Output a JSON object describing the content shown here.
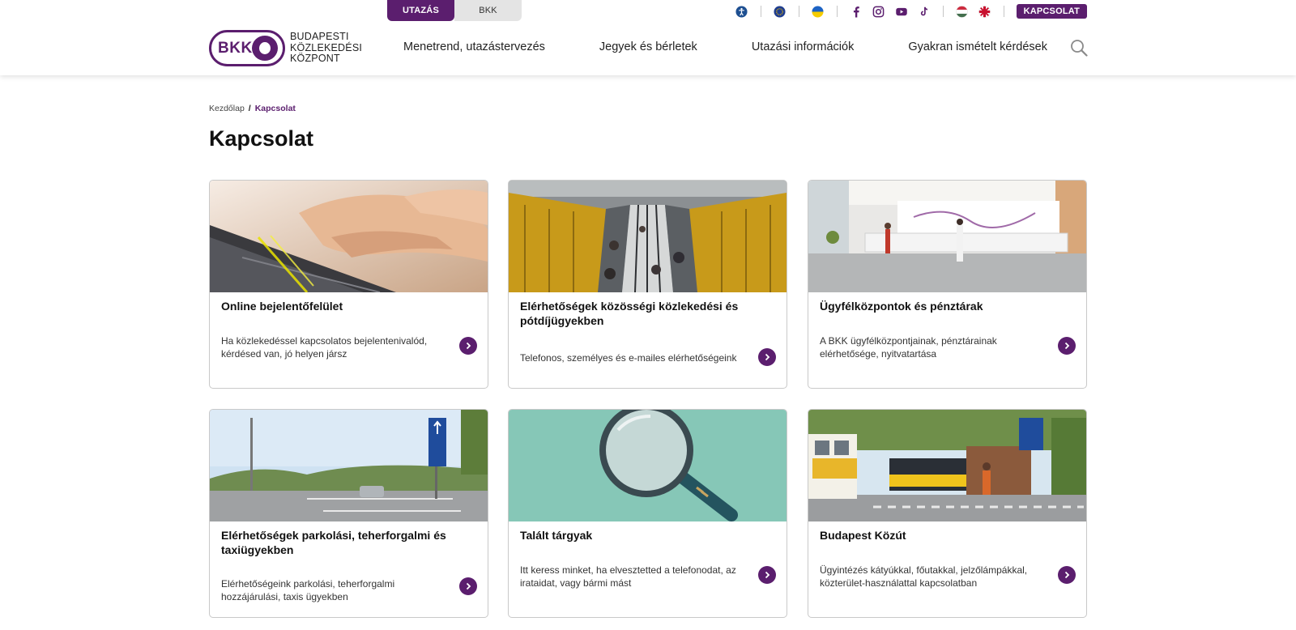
{
  "header": {
    "toggle": {
      "active": "UTAZÁS",
      "inactive": "BKK"
    },
    "utility_icons": [
      "accessibility-icon",
      "eu-icon",
      "ukraine-flag-icon",
      "facebook-icon",
      "instagram-icon",
      "youtube-icon",
      "tiktok-icon",
      "hungarian-flag-icon",
      "english-flag-icon"
    ],
    "contact_button": "KAPCSOLAT",
    "logo": {
      "mark": "BKK",
      "line1": "BUDAPESTI",
      "line2": "KÖZLEKEDÉSI",
      "line3": "KÖZPONT"
    },
    "nav": [
      "Menetrend, utazástervezés",
      "Jegyek és bérletek",
      "Utazási információk",
      "Gyakran ismételt kérdések"
    ]
  },
  "breadcrumb": {
    "home": "Kezdőlap",
    "separator": "/",
    "current": "Kapcsolat"
  },
  "page_title": "Kapcsolat",
  "cards": [
    {
      "title": "Online bejelentőfelület",
      "description": "Ha közlekedéssel kapcsolatos bejelentenivalód, kérdésed van, jó helyen jársz"
    },
    {
      "title": "Elérhetőségek közösségi közlekedési és pótdíjügyekben",
      "description": "Telefonos, személyes és e-mailes elérhetőségeink"
    },
    {
      "title": "Ügyfélközpontok és pénztárak",
      "description": "A BKK ügyfélközpontjainak, pénztárainak elérhetősége, nyitvatartása"
    },
    {
      "title": "Elérhetőségek parkolási, teherforgalmi és taxiügyekben",
      "description": "Elérhetőségeink parkolási, teherforgalmi hozzájárulási, taxis ügyekben"
    },
    {
      "title": "Talált tárgyak",
      "description": "Itt keress minket, ha elvesztetted a telefonodat, az irataidat, vagy bármi mást"
    },
    {
      "title": "Budapest Közút",
      "description": "Ügyintézés kátyúkkal, főutakkal, jelzőlámpákkal, közterület-használattal kapcsolatban"
    }
  ],
  "colors": {
    "brand": "#5b1e6e",
    "border": "#c9c9c9",
    "toggle_inactive": "#e4e4e4"
  }
}
